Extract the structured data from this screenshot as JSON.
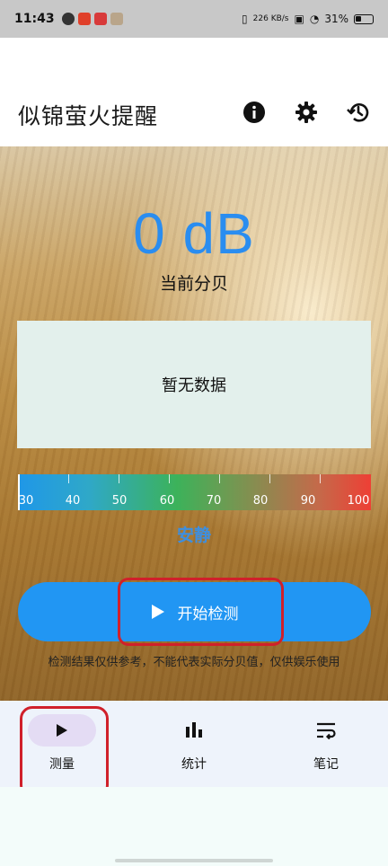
{
  "status": {
    "time": "11:43",
    "net_speed": "226 KB/s",
    "battery": "31%"
  },
  "appbar": {
    "title": "似锦萤火提醒",
    "actions": [
      "info-icon",
      "settings-icon",
      "history-icon"
    ]
  },
  "meter": {
    "value_text": "0 dB",
    "value_label": "当前分贝",
    "chart_empty": "暂无数据",
    "scale_labels": [
      "30",
      "40",
      "50",
      "60",
      "70",
      "80",
      "90",
      "100"
    ],
    "level_text": "安静",
    "start_label": "开始检测",
    "disclaimer": "检测结果仅供参考，不能代表实际分贝值，仅供娱乐使用"
  },
  "nav": {
    "items": [
      {
        "label": "测量",
        "icon": "play-icon",
        "active": true
      },
      {
        "label": "统计",
        "icon": "bar-chart-icon",
        "active": false
      },
      {
        "label": "笔记",
        "icon": "notes-icon",
        "active": false
      }
    ]
  },
  "colors": {
    "accent": "#2196f3",
    "db_text": "#2a8df0",
    "highlight": "#d0202a"
  }
}
